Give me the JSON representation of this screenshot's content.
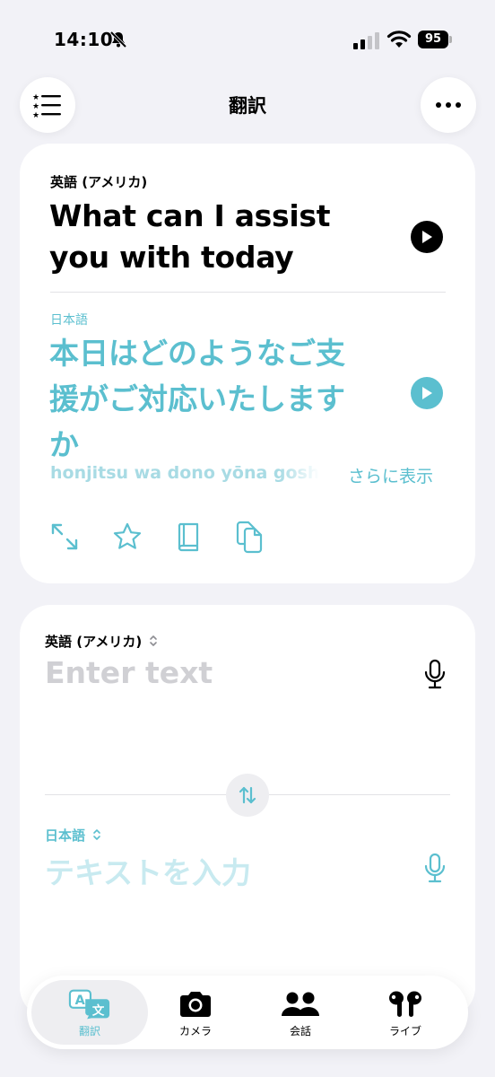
{
  "status": {
    "time": "14:10",
    "battery": "95"
  },
  "header": {
    "title": "翻訳"
  },
  "result": {
    "source_language": "英語 (アメリカ)",
    "source_text_line1": "What can I assist",
    "source_text_line2": "you with today",
    "target_language": "日本語",
    "target_text_line1": "本日はどのようなご支",
    "target_text_line2": "援がご対応いたします",
    "target_text_line3": "か",
    "romanized": "honjitsu wa dono yōna goshien ga go taiō itashimasu ka",
    "show_more": "さらに表示"
  },
  "input": {
    "source_language": "英語 (アメリカ)",
    "source_placeholder": "Enter text",
    "target_language": "日本語",
    "target_placeholder": "テキストを入力"
  },
  "tabs": [
    {
      "label": "翻訳",
      "icon": "translate-icon",
      "active": true
    },
    {
      "label": "カメラ",
      "icon": "camera-icon",
      "active": false
    },
    {
      "label": "会話",
      "icon": "conversation-icon",
      "active": false
    },
    {
      "label": "ライブ",
      "icon": "airpods-icon",
      "active": false
    }
  ],
  "colors": {
    "accent": "#5bbfcf",
    "background": "#f2f2f7",
    "card": "#ffffff"
  }
}
